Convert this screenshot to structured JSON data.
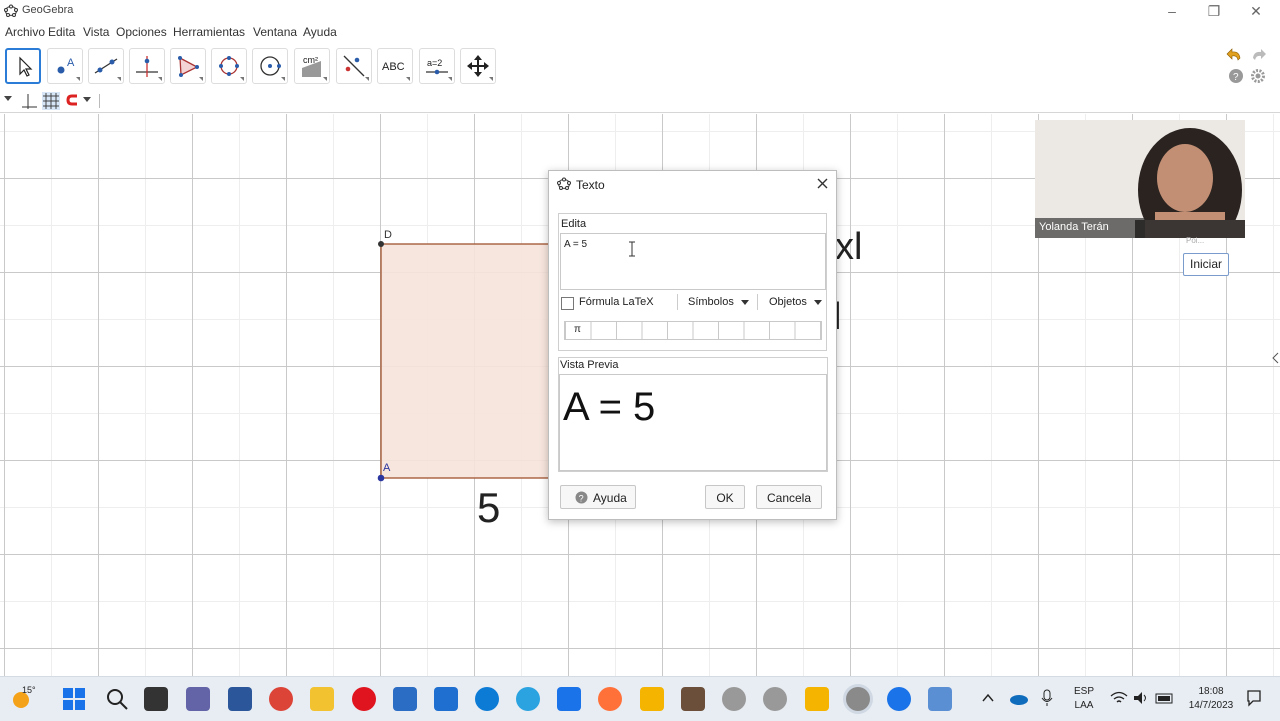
{
  "app": {
    "title": "GeoGebra",
    "window_buttons": [
      "–",
      "❐",
      "✕"
    ]
  },
  "menu": [
    "Archivo",
    "Edita",
    "Vista",
    "Opciones",
    "Herramientas",
    "Ventana",
    "Ayuda"
  ],
  "toolbar": {
    "tools": [
      {
        "icon": "move-arrow-icon",
        "active": true
      },
      {
        "icon": "point-icon",
        "label": "A"
      },
      {
        "icon": "line-icon"
      },
      {
        "icon": "perpendicular-icon"
      },
      {
        "icon": "polygon-icon"
      },
      {
        "icon": "circle-icon"
      },
      {
        "icon": "conic-icon"
      },
      {
        "icon": "area-icon",
        "label": "cm²"
      },
      {
        "icon": "reflect-icon"
      },
      {
        "icon": "text-icon",
        "label": "ABC"
      },
      {
        "icon": "slider-icon",
        "label": "a=2"
      },
      {
        "icon": "move-view-icon"
      }
    ]
  },
  "canvas": {
    "point_labels": {
      "A": "A",
      "D": "D"
    },
    "side_label": "5",
    "partial_text_1": "xl",
    "partial_text_2": "l"
  },
  "dialog": {
    "title": "Texto",
    "edit_legend": "Edita",
    "edit_value": "A = 5",
    "latex_label": "Fórmula LaTeX",
    "symbols_label": "Símbolos",
    "objects_label": "Objetos",
    "symbol_first": "π",
    "preview_legend": "Vista Previa",
    "preview_value": "A = 5",
    "help_label": "Ayuda",
    "ok_label": "OK",
    "cancel_label": "Cancela"
  },
  "video": {
    "person_name": "Yolanda Terán",
    "start_button": "Iniciar",
    "small_text": "Poi..."
  },
  "taskbar": {
    "weather": "15°",
    "tray_lang_1": "ESP",
    "tray_lang_2": "LAA",
    "time": "18:08",
    "date": "14/7/2023"
  },
  "colors": {
    "accent": "#2a7cd6",
    "polygon_fill": "#f6e3da",
    "polygon_stroke": "#a0522d"
  }
}
